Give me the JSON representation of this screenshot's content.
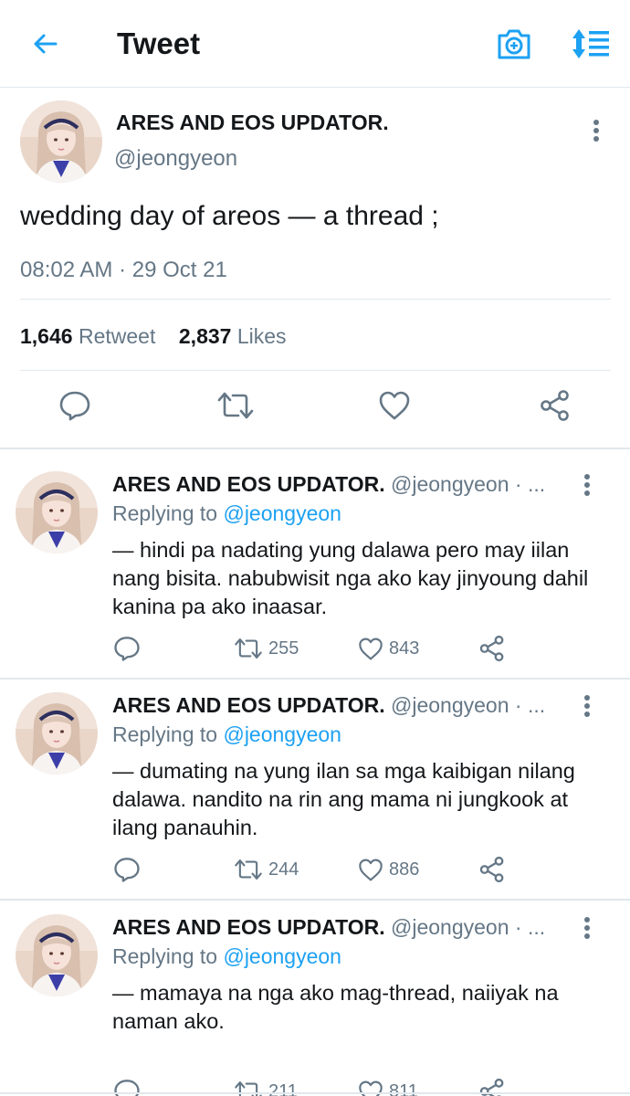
{
  "header": {
    "title": "Tweet",
    "back_icon": "arrow-left-icon",
    "camera_icon": "camera-plus-icon",
    "sort_icon": "sort-list-icon",
    "accent": "#1da1f2"
  },
  "main_tweet": {
    "name": "ARES AND EOS UPDATOR.",
    "handle": "@jeongyeon",
    "text": "wedding day of areos — a thread ;",
    "timestamp": "08:02 AM · 29 Oct 21",
    "retweet_count": "1,646",
    "retweet_label": "Retweet",
    "like_count": "2,837",
    "like_label": "Likes"
  },
  "replies": [
    {
      "name": "ARES AND EOS UPDATOR.",
      "handle": "@jeongyeon · ...",
      "replying_label": "Replying to",
      "replying_to": "@jeongyeon",
      "text": "— hindi pa nadating yung dalawa pero may iilan nang bisita. nabubwisit nga ako kay jinyoung dahil kanina pa ako inaasar.",
      "retweets": "255",
      "likes": "843"
    },
    {
      "name": "ARES AND EOS UPDATOR.",
      "handle": "@jeongyeon · ...",
      "replying_label": "Replying to",
      "replying_to": "@jeongyeon",
      "text": "— dumating na yung ilan sa mga kaibigan nilang dalawa. nandito na rin ang mama ni jungkook at ilang panauhin.",
      "retweets": "244",
      "likes": "886"
    },
    {
      "name": "ARES AND EOS UPDATOR.",
      "handle": "@jeongyeon · ...",
      "replying_label": "Replying to",
      "replying_to": "@jeongyeon",
      "text": "— mamaya na nga ako mag-thread, naiiyak na naman ako.",
      "retweets": "211",
      "likes": "811"
    }
  ]
}
